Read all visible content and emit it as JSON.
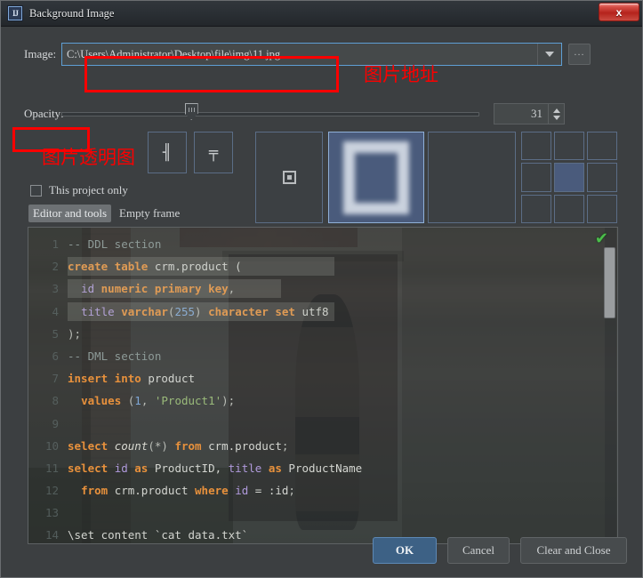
{
  "window": {
    "title": "Background Image",
    "app_icon": "IJ",
    "close_label": "x"
  },
  "image_field": {
    "label": "Image:",
    "value": "C:\\Users\\Administrator\\Desktop\\file\\img\\11.jpg",
    "placeholder": "",
    "dropdown_icon": "chevron-down-icon",
    "browse_label": "..."
  },
  "opacity": {
    "label": "Opacity:",
    "value": "31",
    "percent": 31,
    "min": 0,
    "max": 100
  },
  "align_buttons": [
    {
      "name": "align-horizontal",
      "glyph": "╢"
    },
    {
      "name": "align-vertical",
      "glyph": "╤"
    }
  ],
  "fill_modes": [
    {
      "name": "fill-center",
      "label": "center",
      "selected": false
    },
    {
      "name": "fill-scale",
      "label": "scale",
      "selected": true
    },
    {
      "name": "fill-tile",
      "label": "tile",
      "selected": false
    }
  ],
  "anchor_grid": {
    "selected_index": 4,
    "cells": [
      0,
      1,
      2,
      3,
      4,
      5,
      6,
      7,
      8
    ]
  },
  "project_checkbox": {
    "label": "This project only",
    "checked": false
  },
  "tabs": [
    {
      "label": "Editor and tools",
      "active": true
    },
    {
      "label": "Empty frame",
      "active": false
    }
  ],
  "preview": {
    "check_icon": "✔",
    "code_lines": [
      {
        "n": "1",
        "tokens": [
          {
            "t": "-- DDL section",
            "c": "cmt"
          }
        ]
      },
      {
        "n": "2",
        "tokens": [
          {
            "t": "create",
            "c": "kw"
          },
          {
            "t": " ",
            "c": "pl"
          },
          {
            "t": "table",
            "c": "kw"
          },
          {
            "t": " crm.product (",
            "c": "pl"
          }
        ]
      },
      {
        "n": "3",
        "tokens": [
          {
            "t": "  ",
            "c": "pl"
          },
          {
            "t": "id",
            "c": "id"
          },
          {
            "t": " ",
            "c": "pl"
          },
          {
            "t": "numeric primary key",
            "c": "kw"
          },
          {
            "t": ",",
            "c": "pun"
          }
        ]
      },
      {
        "n": "4",
        "tokens": [
          {
            "t": "  ",
            "c": "pl"
          },
          {
            "t": "title",
            "c": "id"
          },
          {
            "t": " ",
            "c": "pl"
          },
          {
            "t": "varchar",
            "c": "kw"
          },
          {
            "t": "(",
            "c": "pun"
          },
          {
            "t": "255",
            "c": "num2"
          },
          {
            "t": ") ",
            "c": "pun"
          },
          {
            "t": "character set",
            "c": "kw"
          },
          {
            "t": " utf8",
            "c": "pl"
          }
        ]
      },
      {
        "n": "5",
        "tokens": [
          {
            "t": ");",
            "c": "pun"
          }
        ]
      },
      {
        "n": "6",
        "tokens": [
          {
            "t": "-- DML section",
            "c": "cmt"
          }
        ]
      },
      {
        "n": "7",
        "tokens": [
          {
            "t": "insert into",
            "c": "kw"
          },
          {
            "t": " product",
            "c": "pl"
          }
        ]
      },
      {
        "n": "8",
        "tokens": [
          {
            "t": "  ",
            "c": "pl"
          },
          {
            "t": "values",
            "c": "kw"
          },
          {
            "t": " (",
            "c": "pun"
          },
          {
            "t": "1",
            "c": "num2"
          },
          {
            "t": ", ",
            "c": "pun"
          },
          {
            "t": "'Product1'",
            "c": "str"
          },
          {
            "t": ");",
            "c": "pun"
          }
        ]
      },
      {
        "n": "9",
        "tokens": [
          {
            "t": "",
            "c": "pl"
          }
        ]
      },
      {
        "n": "10",
        "tokens": [
          {
            "t": "select",
            "c": "kw"
          },
          {
            "t": " ",
            "c": "pl"
          },
          {
            "t": "count",
            "c": "fn"
          },
          {
            "t": "(*) ",
            "c": "pun"
          },
          {
            "t": "from",
            "c": "kw"
          },
          {
            "t": " crm.product",
            "c": "pl"
          },
          {
            "t": ";",
            "c": "pun"
          }
        ]
      },
      {
        "n": "11",
        "tokens": [
          {
            "t": "select",
            "c": "kw"
          },
          {
            "t": " ",
            "c": "pl"
          },
          {
            "t": "id",
            "c": "id"
          },
          {
            "t": " ",
            "c": "pl"
          },
          {
            "t": "as",
            "c": "kw"
          },
          {
            "t": " ProductID, ",
            "c": "pl"
          },
          {
            "t": "title",
            "c": "id"
          },
          {
            "t": " ",
            "c": "pl"
          },
          {
            "t": "as",
            "c": "kw"
          },
          {
            "t": " ProductName",
            "c": "pl"
          }
        ]
      },
      {
        "n": "12",
        "tokens": [
          {
            "t": "  ",
            "c": "pl"
          },
          {
            "t": "from",
            "c": "kw"
          },
          {
            "t": " crm.product ",
            "c": "pl"
          },
          {
            "t": "where",
            "c": "kw"
          },
          {
            "t": " ",
            "c": "pl"
          },
          {
            "t": "id",
            "c": "id"
          },
          {
            "t": " = :id",
            "c": "pl"
          },
          {
            "t": ";",
            "c": "pun"
          }
        ]
      },
      {
        "n": "13",
        "tokens": [
          {
            "t": "",
            "c": "pl"
          }
        ]
      },
      {
        "n": "14",
        "tokens": [
          {
            "t": "\\set content `cat data.txt`",
            "c": "pl"
          }
        ]
      }
    ]
  },
  "footer": {
    "ok": "OK",
    "cancel": "Cancel",
    "clear_and_close": "Clear and Close"
  },
  "annotations": {
    "path_note": "图片地址",
    "opacity_note": "图片透明图",
    "color": "#fb0000"
  }
}
